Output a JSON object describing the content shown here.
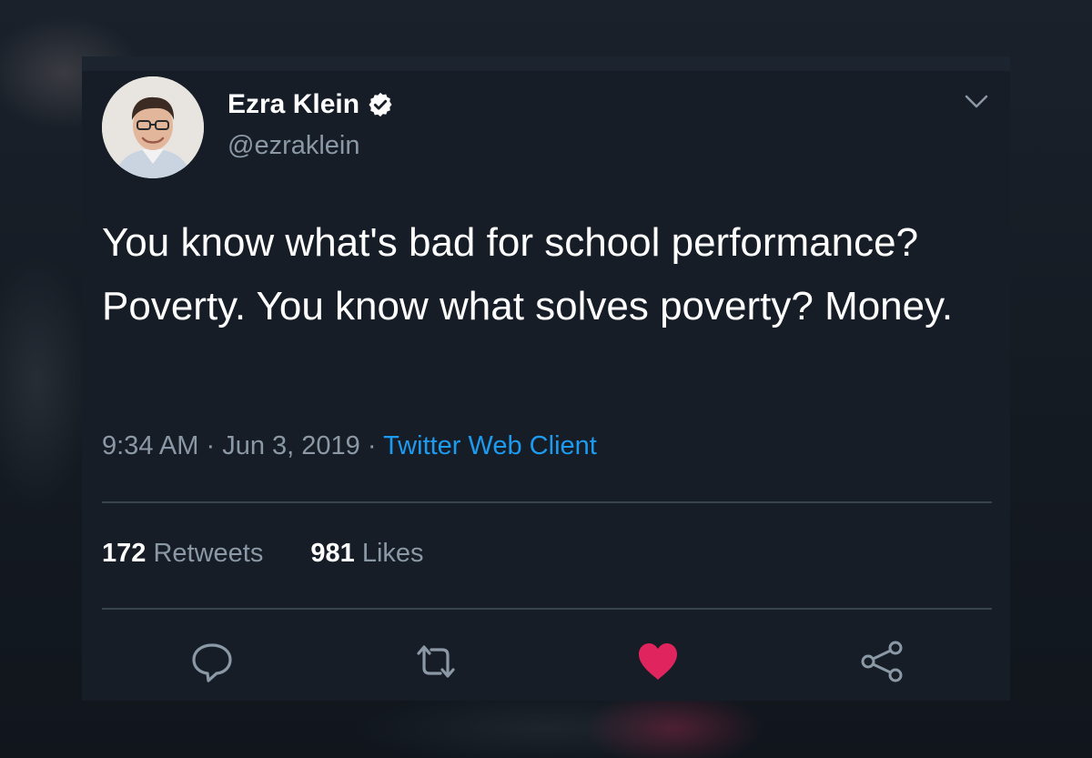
{
  "tweet": {
    "author": {
      "display_name": "Ezra Klein",
      "handle": "@ezraklein",
      "verified": true
    },
    "text": "You know what's bad for school performance? Poverty. You know what solves poverty? Money.",
    "time": "9:34 AM",
    "separator": "·",
    "date": "Jun 3, 2019",
    "source": "Twitter Web Client",
    "stats": {
      "retweets_count": "172",
      "retweets_label": "Retweets",
      "likes_count": "981",
      "likes_label": "Likes"
    },
    "liked": true
  },
  "colors": {
    "background": "#161d27",
    "text_primary": "#ffffff",
    "text_secondary": "#8b98a5",
    "link": "#1d9bf0",
    "like": "#e0245e",
    "divider": "#38444d"
  },
  "icons": {
    "verified": "verified-badge-icon",
    "menu": "chevron-down-icon",
    "reply": "reply-icon",
    "retweet": "retweet-icon",
    "like": "heart-icon",
    "share": "share-icon"
  }
}
